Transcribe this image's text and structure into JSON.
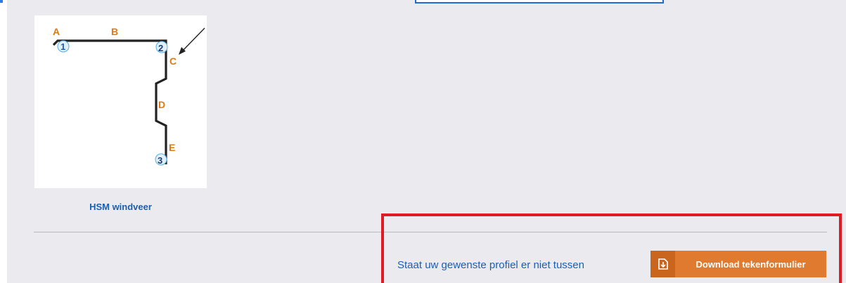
{
  "profile": {
    "caption": "HSM windveer",
    "diagram_labels": {
      "a": "A",
      "b": "B",
      "c": "C",
      "d": "D",
      "e": "E",
      "n1": "1",
      "n2": "2",
      "n3": "3"
    }
  },
  "cta": {
    "text": "Staat uw gewenste profiel er niet tussen",
    "button_label": "Download tekenformulier",
    "button_icon": "download-file-icon"
  },
  "colors": {
    "background": "#ebebef",
    "link_blue": "#1a5fb4",
    "dimension_orange": "#e07a10",
    "button_orange": "#e07a2e",
    "highlight_red": "#e01b24"
  }
}
